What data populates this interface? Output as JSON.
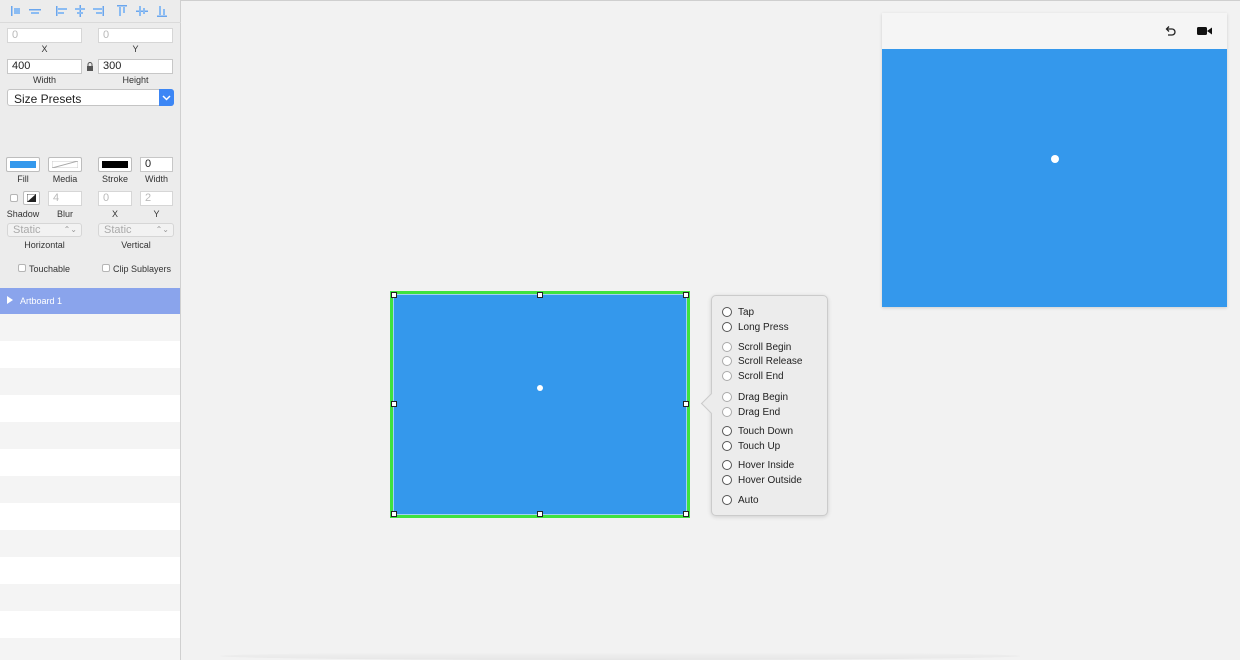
{
  "inspector": {
    "position": {
      "x_value": "0",
      "x_label": "X",
      "y_value": "0",
      "y_label": "Y",
      "width_value": "400",
      "width_label": "Width",
      "height_value": "300",
      "height_label": "Height"
    },
    "size_presets_label": "Size Presets",
    "appearance": {
      "fill_label": "Fill",
      "fill_color": "#3498ec",
      "media_label": "Media",
      "stroke_label": "Stroke",
      "stroke_color": "#000000",
      "stroke_width_value": "0",
      "stroke_width_label": "Width"
    },
    "shadow": {
      "shadow_label": "Shadow",
      "blur_value": "4",
      "blur_label": "Blur",
      "x_value": "0",
      "x_label": "X",
      "y_value": "2",
      "y_label": "Y"
    },
    "constraints": {
      "horizontal_value": "Static",
      "horizontal_label": "Horizontal",
      "vertical_value": "Static",
      "vertical_label": "Vertical"
    },
    "touchable_label": "Touchable",
    "clip_sublayers_label": "Clip Sublayers"
  },
  "layers": {
    "selected_name": "Artboard 1"
  },
  "event_menu": {
    "groups": [
      [
        {
          "label": "Tap",
          "enabled": true
        },
        {
          "label": "Long Press",
          "enabled": true
        }
      ],
      [
        {
          "label": "Scroll Begin",
          "enabled": false
        },
        {
          "label": "Scroll Release",
          "enabled": false
        },
        {
          "label": "Scroll End",
          "enabled": false
        }
      ],
      [
        {
          "label": "Drag Begin",
          "enabled": false
        },
        {
          "label": "Drag End",
          "enabled": false
        }
      ],
      [
        {
          "label": "Touch Down",
          "enabled": true
        },
        {
          "label": "Touch Up",
          "enabled": true
        }
      ],
      [
        {
          "label": "Hover Inside",
          "enabled": true
        },
        {
          "label": "Hover Outside",
          "enabled": true
        }
      ],
      [
        {
          "label": "Auto",
          "enabled": true
        }
      ]
    ],
    "item_labels": [
      "Tap",
      "Long Press",
      "Scroll Begin",
      "Scroll Release",
      "Scroll End",
      "Drag Begin",
      "Drag End",
      "Touch Down",
      "Touch Up",
      "Hover Inside",
      "Hover Outside",
      "Auto"
    ]
  },
  "colors": {
    "layer_fill": "#3498ec",
    "selection_outline": "#3fe23f",
    "accent": "#3c86f5",
    "layer_row_selected": "#8aa4ec"
  },
  "preview": {
    "undo_icon": "undo-icon",
    "record_icon": "video-camera-icon"
  }
}
